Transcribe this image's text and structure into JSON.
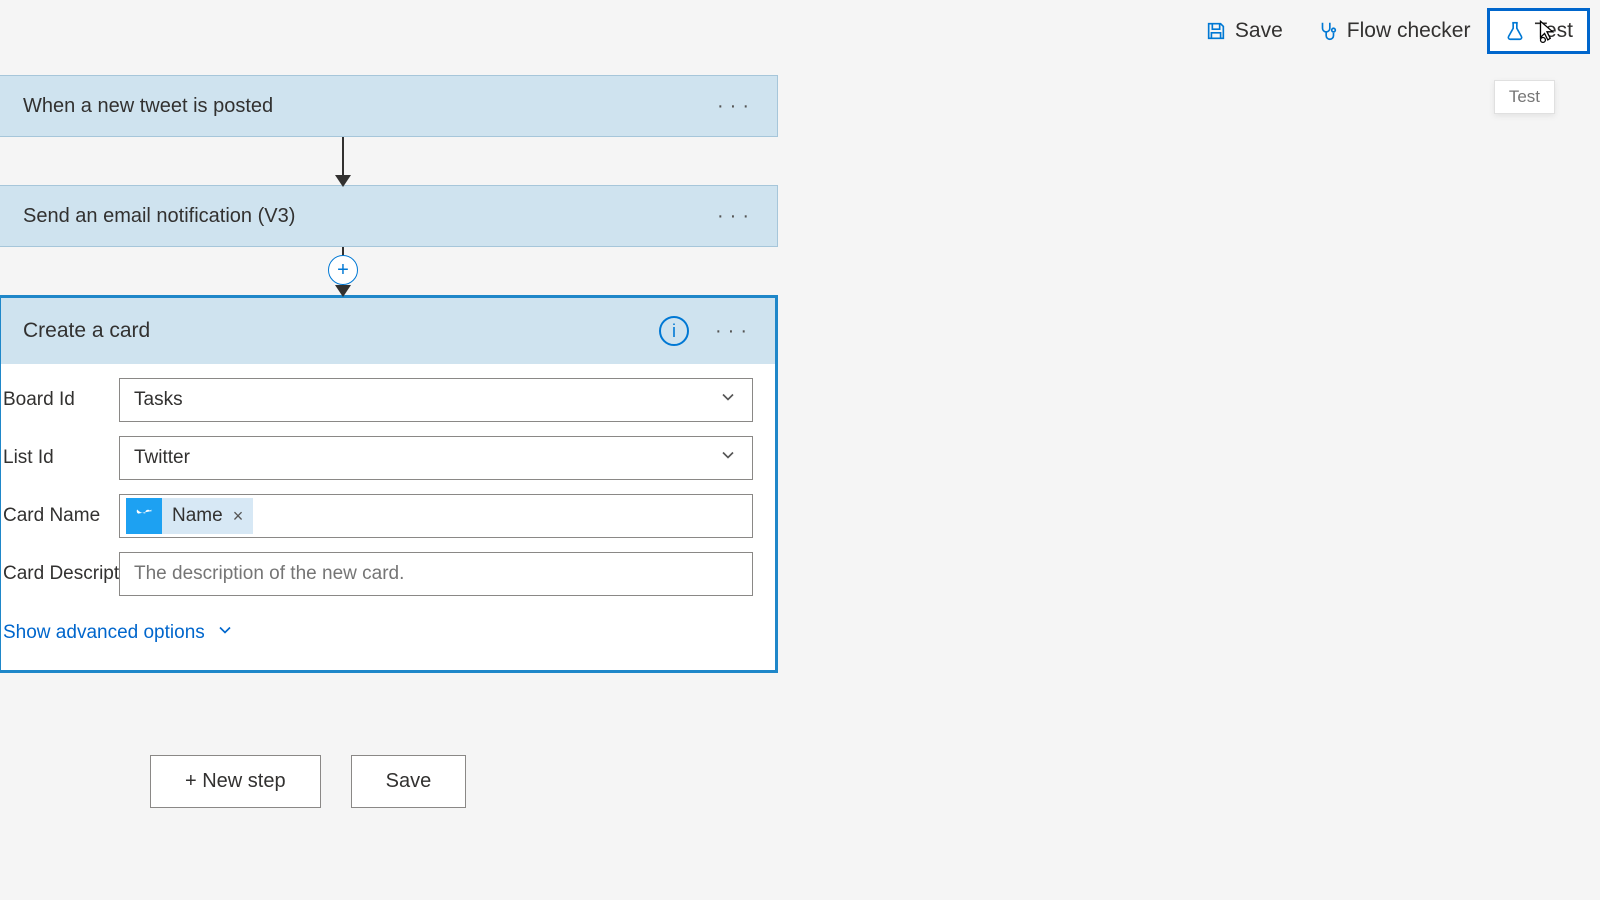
{
  "toolbar": {
    "save": "Save",
    "flow_checker": "Flow checker",
    "test": "Test",
    "tooltip": "Test"
  },
  "flow": {
    "trigger": {
      "title": "When a new tweet is posted"
    },
    "action1": {
      "title": "Send an email notification (V3)"
    },
    "action2": {
      "title": "Create a card",
      "fields": {
        "board": {
          "label": "Board Id",
          "value": "Tasks"
        },
        "list": {
          "label": "List Id",
          "value": "Twitter"
        },
        "name": {
          "label": "Card Name",
          "token": "Name"
        },
        "desc": {
          "label": "Card Description",
          "placeholder": "The description of the new card."
        }
      },
      "advanced": "Show advanced options"
    }
  },
  "buttons": {
    "new_step": "+ New step",
    "save": "Save"
  }
}
